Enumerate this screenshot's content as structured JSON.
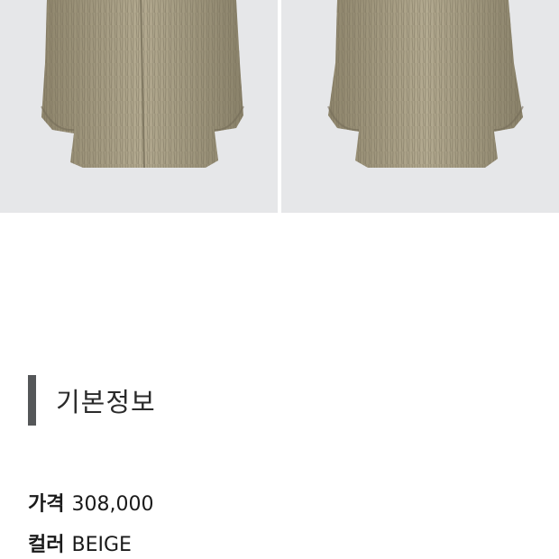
{
  "gallery": {
    "images": [
      {
        "name": "fur-coat-photo-1"
      },
      {
        "name": "fur-coat-photo-2"
      }
    ],
    "background_color": "#e6e7e9",
    "fur_color": "#a99f86"
  },
  "basic_info": {
    "title": "기본정보",
    "price_label": "가격",
    "price_value": "308,000",
    "color_label": "컬러",
    "color_value": "BEIGE"
  }
}
